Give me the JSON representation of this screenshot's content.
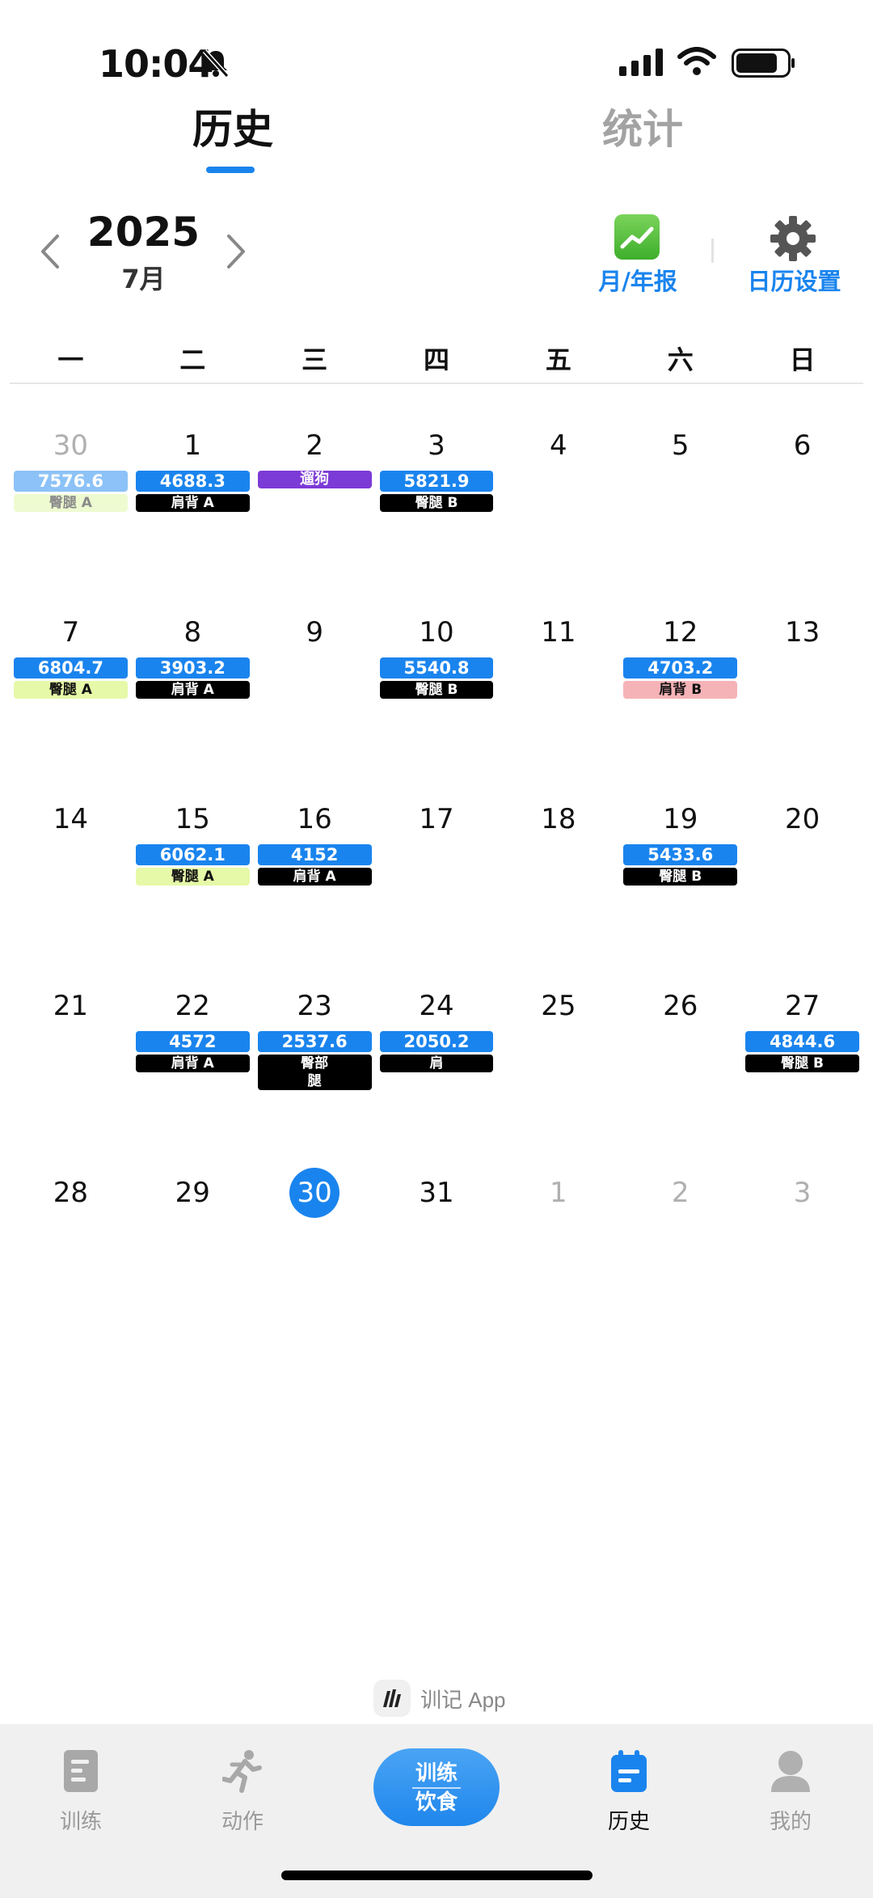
{
  "status": {
    "time": "10:04"
  },
  "tabs": {
    "history": "历史",
    "stats": "统计"
  },
  "header": {
    "year": "2025",
    "month": "7月",
    "report_label": "月/年报",
    "settings_label": "日历设置"
  },
  "weekdays": [
    "一",
    "二",
    "三",
    "四",
    "五",
    "六",
    "日"
  ],
  "calendar": {
    "weeks": [
      [
        {
          "day": "30",
          "other": true,
          "vol": "7576.6",
          "label": "臀腿 A"
        },
        {
          "day": "1",
          "vol": "4688.3",
          "label": "肩背 A"
        },
        {
          "day": "2",
          "vol": "遛狗"
        },
        {
          "day": "3",
          "vol": "5821.9",
          "label": "臀腿 B"
        },
        {
          "day": "4"
        },
        {
          "day": "5"
        },
        {
          "day": "6"
        }
      ],
      [
        {
          "day": "7",
          "vol": "6804.7",
          "label": "臀腿 A"
        },
        {
          "day": "8",
          "vol": "3903.2",
          "label": "肩背 A"
        },
        {
          "day": "9"
        },
        {
          "day": "10",
          "vol": "5540.8",
          "label": "臀腿 B"
        },
        {
          "day": "11"
        },
        {
          "day": "12",
          "vol": "4703.2",
          "label": "肩背 B"
        },
        {
          "day": "13"
        }
      ],
      [
        {
          "day": "14"
        },
        {
          "day": "15",
          "vol": "6062.1",
          "label": "臀腿 A"
        },
        {
          "day": "16",
          "vol": "4152",
          "label": "肩背 A"
        },
        {
          "day": "17"
        },
        {
          "day": "18"
        },
        {
          "day": "19",
          "vol": "5433.6",
          "label": "臀腿 B"
        },
        {
          "day": "20"
        }
      ],
      [
        {
          "day": "21"
        },
        {
          "day": "22",
          "vol": "4572",
          "label": "肩背 A"
        },
        {
          "day": "23",
          "vol": "2537.6",
          "label": "臀部",
          "label2": "腿"
        },
        {
          "day": "24",
          "vol": "2050.2",
          "label": "肩"
        },
        {
          "day": "25"
        },
        {
          "day": "26"
        },
        {
          "day": "27",
          "vol": "4844.6",
          "label": "臀腿 B"
        }
      ],
      [
        {
          "day": "28"
        },
        {
          "day": "29"
        },
        {
          "day": "30",
          "today": true
        },
        {
          "day": "31"
        },
        {
          "day": "1",
          "other": true
        },
        {
          "day": "2",
          "other": true
        },
        {
          "day": "3",
          "other": true
        }
      ]
    ]
  },
  "brand": {
    "text": "训记 App"
  },
  "tabbar": {
    "train": "训练",
    "action": "动作",
    "center_top": "训练",
    "center_bottom": "饮食",
    "history": "历史",
    "mine": "我的"
  },
  "colors": {
    "accent": "#1a84ee",
    "purple": "#7c3ad6",
    "green_label": "#e6f9a8",
    "pink_label": "#f6b3b7"
  },
  "icons": [
    "bell-slash-icon",
    "signal-icon",
    "wifi-icon",
    "battery-icon",
    "chevron-left-icon",
    "chevron-right-icon",
    "trend-chart-icon",
    "gear-icon",
    "document-icon",
    "runner-icon",
    "calendar-icon",
    "person-icon"
  ]
}
